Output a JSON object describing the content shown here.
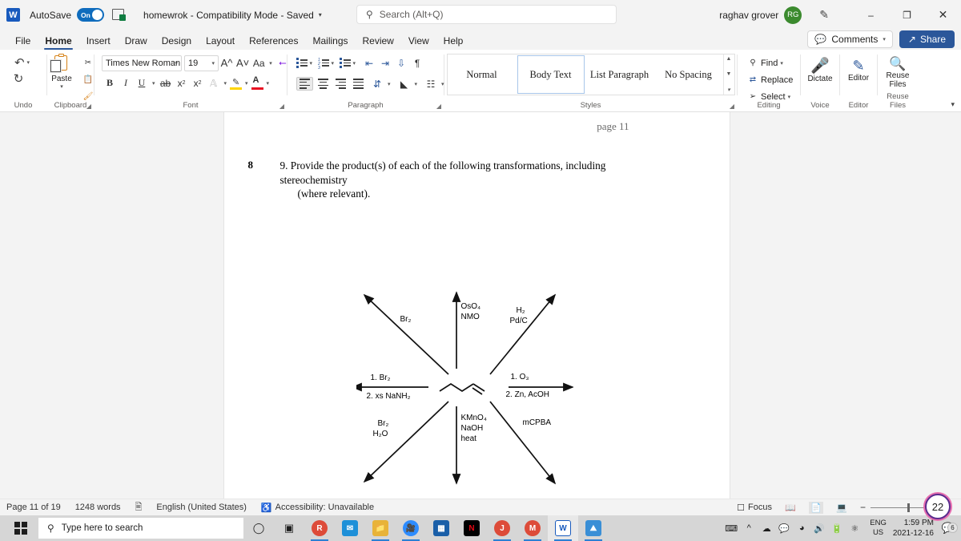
{
  "titlebar": {
    "app_logo": "W",
    "autosave_label": "AutoSave",
    "autosave_state": "On",
    "doc_title": "homewrok  -  Compatibility Mode  -  Saved",
    "search_placeholder": "Search (Alt+Q)",
    "user_name": "raghav grover",
    "user_initials": "RG",
    "minimize": "–",
    "restore": "❐",
    "close": "✕"
  },
  "tabs": [
    {
      "label": "File",
      "active": false
    },
    {
      "label": "Home",
      "active": true
    },
    {
      "label": "Insert",
      "active": false
    },
    {
      "label": "Draw",
      "active": false
    },
    {
      "label": "Design",
      "active": false
    },
    {
      "label": "Layout",
      "active": false
    },
    {
      "label": "References",
      "active": false
    },
    {
      "label": "Mailings",
      "active": false
    },
    {
      "label": "Review",
      "active": false
    },
    {
      "label": "View",
      "active": false
    },
    {
      "label": "Help",
      "active": false
    }
  ],
  "tabs_right": {
    "comments_label": "Comments",
    "share_label": "Share"
  },
  "ribbon": {
    "undo": {
      "group_label": "Undo"
    },
    "clipboard": {
      "group_label": "Clipboard",
      "paste_label": "Paste"
    },
    "font": {
      "group_label": "Font",
      "font_name": "Times New Roman",
      "font_size": "19",
      "grow_label": "A",
      "shrink_label": "A",
      "change_case_label": "Aa",
      "bold": "B",
      "italic": "I",
      "underline": "U",
      "strikethrough": "ab",
      "subscript": "x",
      "superscript": "x",
      "text_effects": "A",
      "highlight": "A",
      "font_color": "A"
    },
    "paragraph": {
      "group_label": "Paragraph"
    },
    "styles": {
      "group_label": "Styles",
      "items": [
        {
          "label": "Normal",
          "selected": false
        },
        {
          "label": "Body Text",
          "selected": true
        },
        {
          "label": "List Paragraph",
          "selected": false
        },
        {
          "label": "No Spacing",
          "selected": false
        }
      ]
    },
    "editing": {
      "group_label": "Editing",
      "find_label": "Find",
      "replace_label": "Replace",
      "select_label": "Select"
    },
    "voice": {
      "group_label": "Voice",
      "dictate_label": "Dictate"
    },
    "editor": {
      "group_label": "Editor",
      "editor_label": "Editor"
    },
    "reuse": {
      "group_label": "Reuse Files",
      "reuse_label": "Reuse\nFiles"
    }
  },
  "document": {
    "page_header": "page 11",
    "question_number": "8",
    "question_text": "9. Provide the product(s) of each of the following transformations, including stereochemistry",
    "question_text_line2": "(where relevant).",
    "scheme": {
      "substrate_name": "pent-2-ene",
      "reactions": [
        {
          "direction": "upper-left",
          "reagents": [
            "Br",
            "2"
          ],
          "label_lines": [
            "Br₂"
          ]
        },
        {
          "direction": "up",
          "label_lines": [
            "OsO₄",
            "NMO"
          ]
        },
        {
          "direction": "upper-right",
          "label_lines": [
            "H₂",
            "Pd/C"
          ]
        },
        {
          "direction": "left",
          "label_lines": [
            "1. Br₂",
            "2. xs NaNH₂"
          ]
        },
        {
          "direction": "right",
          "label_lines": [
            "1. O₃",
            "2. Zn, AcOH"
          ]
        },
        {
          "direction": "lower-left",
          "label_lines": [
            "Br₂",
            "H₂O"
          ]
        },
        {
          "direction": "down",
          "label_lines": [
            "KMnO₄",
            "NaOH",
            "heat"
          ]
        },
        {
          "direction": "lower-right",
          "label_lines": [
            "mCPBA"
          ]
        }
      ]
    }
  },
  "statusbar": {
    "page": "Page 11 of 19",
    "words": "1248 words",
    "language": "English (United States)",
    "accessibility": "Accessibility: Unavailable",
    "focus_label": "Focus",
    "zoom_level": ""
  },
  "taskbar": {
    "search_placeholder": "Type here to search",
    "apps": [
      {
        "name": "cortana",
        "glyph": "○",
        "color": "transparent",
        "running": false
      },
      {
        "name": "task-view",
        "glyph": "☰",
        "color": "transparent",
        "running": false
      },
      {
        "name": "chrome-profile-r",
        "glyph": "",
        "color": "#dd4b39",
        "running": true
      },
      {
        "name": "mail",
        "glyph": "✉",
        "color": "#1e90d8",
        "running": false
      },
      {
        "name": "file-explorer",
        "glyph": "🗀",
        "color": "#e8b339",
        "running": true
      },
      {
        "name": "zoom",
        "glyph": "▶",
        "color": "#2d8cff",
        "running": true
      },
      {
        "name": "microsoft-store",
        "glyph": "⊞",
        "color": "#1a5fa8",
        "running": false
      },
      {
        "name": "netflix",
        "glyph": "N",
        "color": "#000000",
        "running": false
      },
      {
        "name": "chrome-profile-j",
        "glyph": "",
        "color": "#dd4b39",
        "running": true
      },
      {
        "name": "chrome-profile-m",
        "glyph": "",
        "color": "#dd4b39",
        "running": true
      },
      {
        "name": "word",
        "glyph": "W",
        "color": "#185abd",
        "running": true,
        "active": true
      },
      {
        "name": "photos",
        "glyph": "⛰",
        "color": "#3a8fd6",
        "running": true
      }
    ],
    "language_line1": "ENG",
    "language_line2": "US",
    "time": "1:59 PM",
    "date": "2021-12-16",
    "notification_count": "6",
    "overlay_badge": "22"
  },
  "colors": {
    "accent": "#2b579a",
    "word_blue": "#185abd",
    "avatar_green": "#3b8a2e",
    "toggle_blue": "#0f6cbd"
  }
}
